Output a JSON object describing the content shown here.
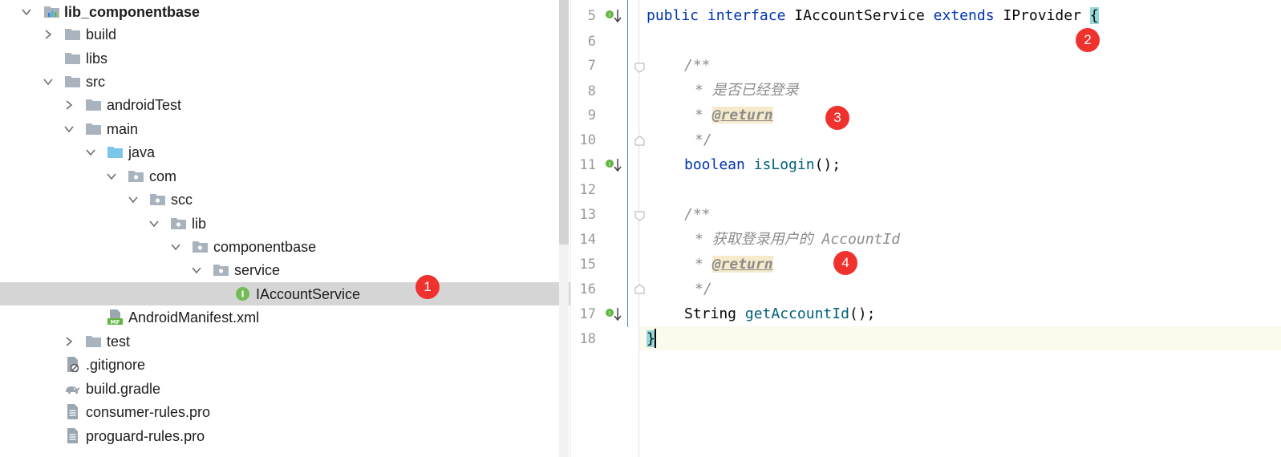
{
  "tree": {
    "items": [
      {
        "label": "lib_componentbase",
        "icon": "module-folder-icon",
        "expanded": true
      },
      {
        "label": "build",
        "icon": "folder-icon",
        "expanded": false
      },
      {
        "label": "libs",
        "icon": "folder-icon"
      },
      {
        "label": "src",
        "icon": "folder-icon",
        "expanded": true
      },
      {
        "label": "androidTest",
        "icon": "folder-icon",
        "expanded": false
      },
      {
        "label": "main",
        "icon": "folder-icon",
        "expanded": true
      },
      {
        "label": "java",
        "icon": "source-folder-icon",
        "expanded": true
      },
      {
        "label": "com",
        "icon": "package-icon",
        "expanded": true
      },
      {
        "label": "scc",
        "icon": "package-icon",
        "expanded": true
      },
      {
        "label": "lib",
        "icon": "package-icon",
        "expanded": true
      },
      {
        "label": "componentbase",
        "icon": "package-icon",
        "expanded": true
      },
      {
        "label": "service",
        "icon": "package-icon",
        "expanded": true
      },
      {
        "label": "IAccountService",
        "icon": "interface-icon",
        "selected": true
      },
      {
        "label": "AndroidManifest.xml",
        "icon": "manifest-icon"
      },
      {
        "label": "test",
        "icon": "folder-icon",
        "expanded": false
      },
      {
        "label": ".gitignore",
        "icon": "gitignore-icon"
      },
      {
        "label": "build.gradle",
        "icon": "gradle-icon"
      },
      {
        "label": "consumer-rules.pro",
        "icon": "text-file-icon"
      },
      {
        "label": "proguard-rules.pro",
        "icon": "text-file-icon"
      }
    ],
    "manifest_badge": "MF",
    "interface_badge": "I"
  },
  "editor": {
    "line_numbers": [
      "5",
      "6",
      "7",
      "8",
      "9",
      "10",
      "11",
      "12",
      "13",
      "14",
      "15",
      "16",
      "17",
      "18"
    ],
    "code": {
      "l5_kw1": "public",
      "l5_kw2": "interface",
      "l5_name": "IAccountService",
      "l5_kw3": "extends",
      "l5_super": "IProvider",
      "l5_brace": "{",
      "l7": "/**",
      "l8": "* 是否已经登录",
      "l9_star": "* ",
      "l9_tag": "@return",
      "l10": "*/",
      "l11_type": "boolean",
      "l11_fn": "isLogin",
      "l11_rest": "();",
      "l13": "/**",
      "l14": "* 获取登录用户的 AccountId",
      "l15_star": "* ",
      "l15_tag": "@return",
      "l16": "*/",
      "l17_type": "String",
      "l17_fn": "getAccountId",
      "l17_rest": "();",
      "l18": "}"
    }
  },
  "badges": [
    "1",
    "2",
    "3",
    "4"
  ],
  "colors": {
    "keyword": "#0033b3",
    "method": "#00627a",
    "comment": "#8c8c8c",
    "badge": "#f0322f",
    "selection": "#d5d5d5"
  }
}
